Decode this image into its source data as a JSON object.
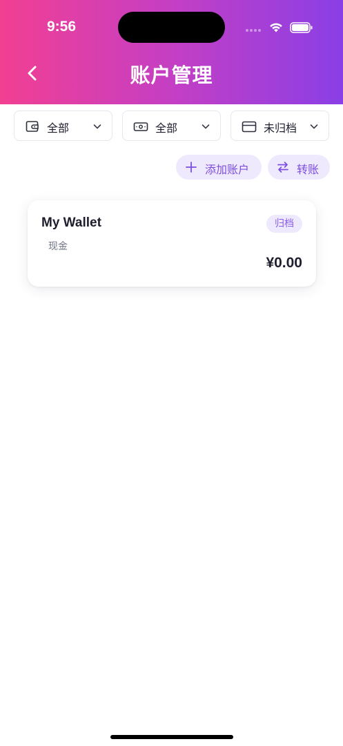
{
  "status_bar": {
    "time": "9:56"
  },
  "header": {
    "title": "账户管理",
    "back_icon": "chevron-left-icon"
  },
  "filters": [
    {
      "label": "全部",
      "icon": "wallet-icon"
    },
    {
      "label": "全部",
      "icon": "banknote-icon"
    },
    {
      "label": "未归档",
      "icon": "credit-card-icon"
    }
  ],
  "actions": {
    "add_label": "添加账户",
    "transfer_label": "转账"
  },
  "accounts": [
    {
      "name": "My Wallet",
      "type": "现金",
      "badge": "归档",
      "balance": "¥0.00"
    }
  ],
  "colors": {
    "header_gradient": [
      "#f23f92",
      "#8a3fe6"
    ],
    "accent": "#7c4ddf",
    "accent_bg": "#efe9fd"
  }
}
